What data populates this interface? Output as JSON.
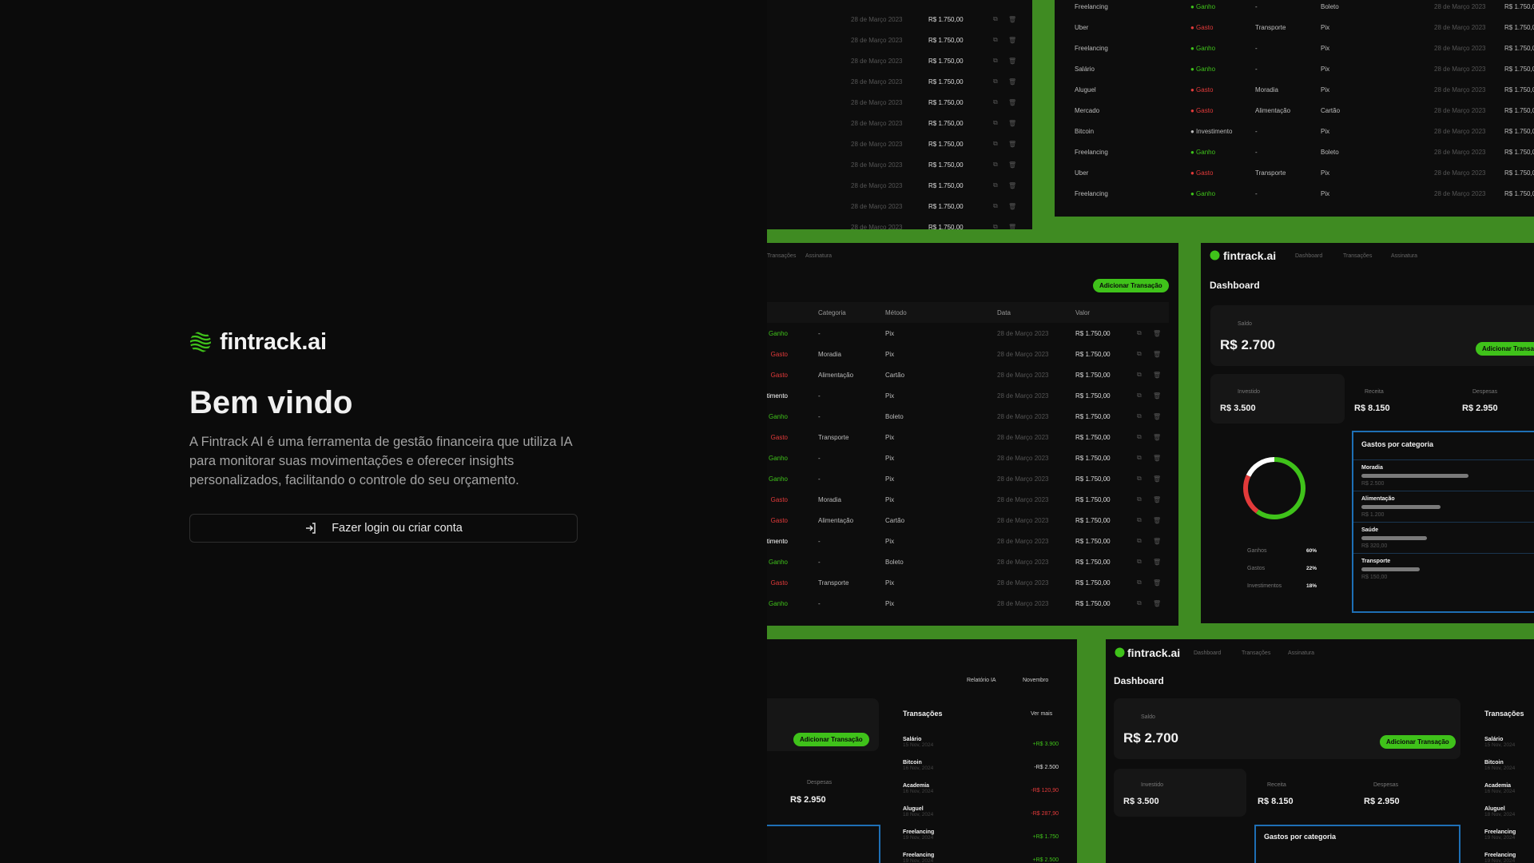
{
  "brand": {
    "name": "fintrack.ai"
  },
  "welcome": {
    "title": "Bem vindo",
    "description": "A Fintrack AI é uma ferramenta de gestão financeira que utiliza IA para monitorar suas movimentações e oferecer insights personalizados, facilitando o controle do seu orçamento.",
    "login_button": "Fazer login ou criar conta"
  },
  "colors": {
    "accent": "#3fc21a",
    "collage_bg": "#3f8b22",
    "background": "#0b0b0b"
  },
  "preview": {
    "date": "28 de Março 2023",
    "amount": "R$ 1.750,00",
    "top_table": [
      [
        "Freelancing",
        "Ganho",
        "-",
        "Boleto"
      ],
      [
        "Uber",
        "Gasto",
        "Transporte",
        "Pix"
      ],
      [
        "Freelancing",
        "Ganho",
        "-",
        "Pix"
      ],
      [
        "Salário",
        "Ganho",
        "-",
        "Pix"
      ],
      [
        "Aluguel",
        "Gasto",
        "Moradia",
        "Pix"
      ],
      [
        "Mercado",
        "Gasto",
        "Alimentação",
        "Cartão"
      ],
      [
        "Bitcoin",
        "Investimento",
        "-",
        "Pix"
      ],
      [
        "Freelancing",
        "Ganho",
        "-",
        "Boleto"
      ],
      [
        "Uber",
        "Gasto",
        "Transporte",
        "Pix"
      ],
      [
        "Freelancing",
        "Ganho",
        "-",
        "Pix"
      ]
    ],
    "mid_table": {
      "tabs": [
        "Transações",
        "Assinatura"
      ],
      "add_button": "Adicionar Transação",
      "headers": [
        "Categoria",
        "Método",
        "Data",
        "Valor"
      ],
      "rows": [
        [
          "Ganho",
          "-",
          "Pix"
        ],
        [
          "Gasto",
          "Moradia",
          "Pix"
        ],
        [
          "Gasto",
          "Alimentação",
          "Cartão"
        ],
        [
          "Investimento",
          "-",
          "Pix"
        ],
        [
          "Ganho",
          "-",
          "Boleto"
        ],
        [
          "Gasto",
          "Transporte",
          "Pix"
        ],
        [
          "Ganho",
          "-",
          "Pix"
        ],
        [
          "Ganho",
          "-",
          "Pix"
        ],
        [
          "Gasto",
          "Moradia",
          "Pix"
        ],
        [
          "Gasto",
          "Alimentação",
          "Cartão"
        ],
        [
          "Investimento",
          "-",
          "Pix"
        ],
        [
          "Ganho",
          "-",
          "Boleto"
        ],
        [
          "Gasto",
          "Transporte",
          "Pix"
        ],
        [
          "Ganho",
          "-",
          "Pix"
        ]
      ]
    },
    "dashboard": {
      "nav": [
        "Dashboard",
        "Transações",
        "Assinatura"
      ],
      "title": "Dashboard",
      "saldo_label": "Saldo",
      "saldo": "R$ 2.700",
      "add_button": "Adicionar Transação",
      "investido_label": "Investido",
      "investido": "R$ 3.500",
      "receita_label": "Receita",
      "receita": "R$ 8.150",
      "despesas_label": "Despesas",
      "despesas": "R$ 2.950",
      "donut": [
        {
          "label": "Ganhos",
          "pct": "60%",
          "value": 60,
          "color": "#3fc21a"
        },
        {
          "label": "Gastos",
          "pct": "22%",
          "value": 22,
          "color": "#e23a3a"
        },
        {
          "label": "Investimentos",
          "pct": "18%",
          "value": 18,
          "color": "#ffffff"
        }
      ],
      "categories_title": "Gastos por categoria",
      "categories": [
        {
          "name": "Moradia",
          "value": "R$ 2.500",
          "fill": 0.62
        },
        {
          "name": "Alimentação",
          "value": "R$ 1.200",
          "fill": 0.46
        },
        {
          "name": "Saúde",
          "value": "R$ 320,00",
          "fill": 0.38
        },
        {
          "name": "Transporte",
          "value": "R$ 150,00",
          "fill": 0.34
        }
      ]
    },
    "bottom": {
      "report": "Relatório IA",
      "month": "Novembro",
      "transactions_title": "Transações",
      "see_more": "Ver mais",
      "transactions": [
        [
          "Salário",
          "15 Nov, 2024",
          "+R$ 3.900",
          "g"
        ],
        [
          "Bitcoin",
          "16 Nov, 2024",
          "-R$ 2.500",
          ""
        ],
        [
          "Academia",
          "16 Nov, 2024",
          "-R$ 120,90",
          "r"
        ],
        [
          "Aluguel",
          "18 Nov, 2024",
          "-R$ 287,90",
          "r"
        ],
        [
          "Freelancing",
          "19 Nov, 2024",
          "+R$ 1.750",
          "g"
        ],
        [
          "Freelancing",
          "19 Nov, 2024",
          "+R$ 2.500",
          "g"
        ]
      ]
    }
  }
}
